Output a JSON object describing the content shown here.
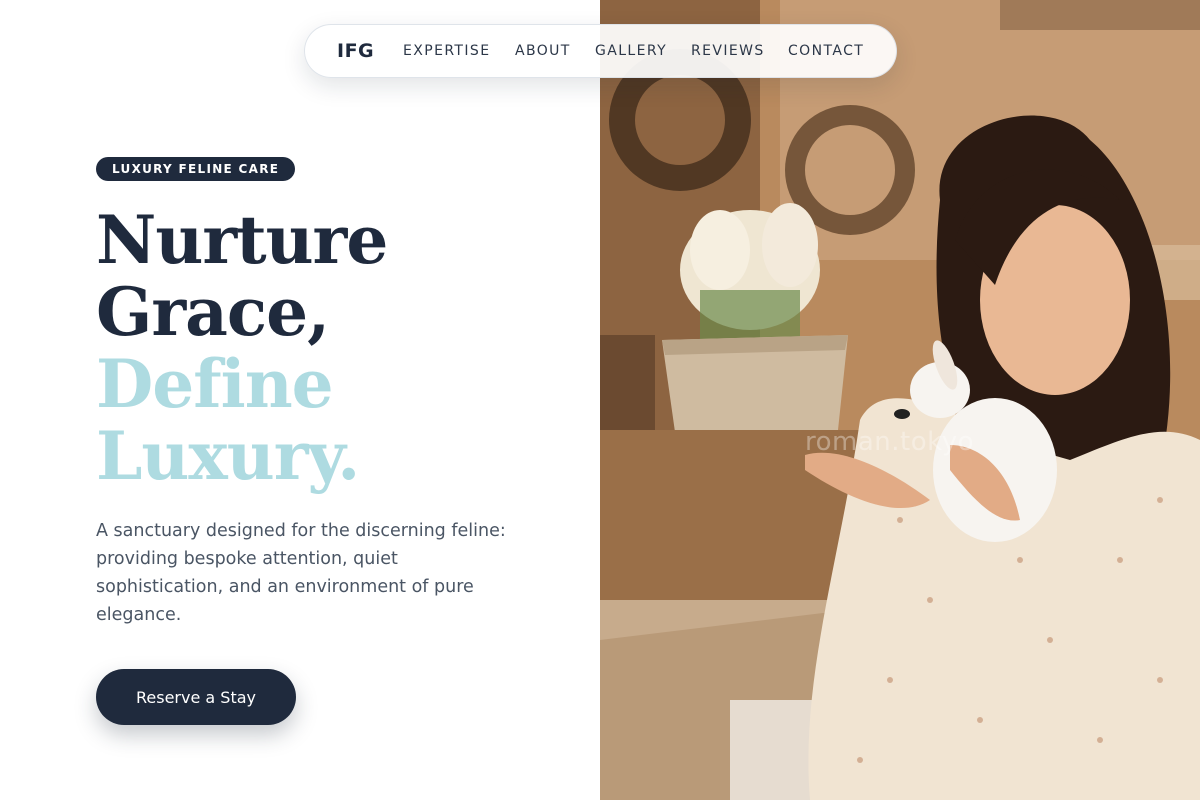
{
  "nav": {
    "logo": "IFG",
    "links": [
      "EXPERTISE",
      "ABOUT",
      "GALLERY",
      "REVIEWS",
      "CONTACT"
    ]
  },
  "hero": {
    "badge": "LUXURY FELINE CARE",
    "headline_dark": [
      "Nurture",
      "Grace,"
    ],
    "headline_light": [
      "Define",
      "Luxury."
    ],
    "description": "A sanctuary designed for the discerning feline: providing bespoke attention, quiet sophistication, and an environment of pure elegance.",
    "cta_label": "Reserve a Stay"
  },
  "photo": {
    "watermark": "roman.tokyo"
  },
  "colors": {
    "navy": "#1f2a3d",
    "accent_light_blue": "#aedbe1",
    "body_text": "#4a5564"
  }
}
